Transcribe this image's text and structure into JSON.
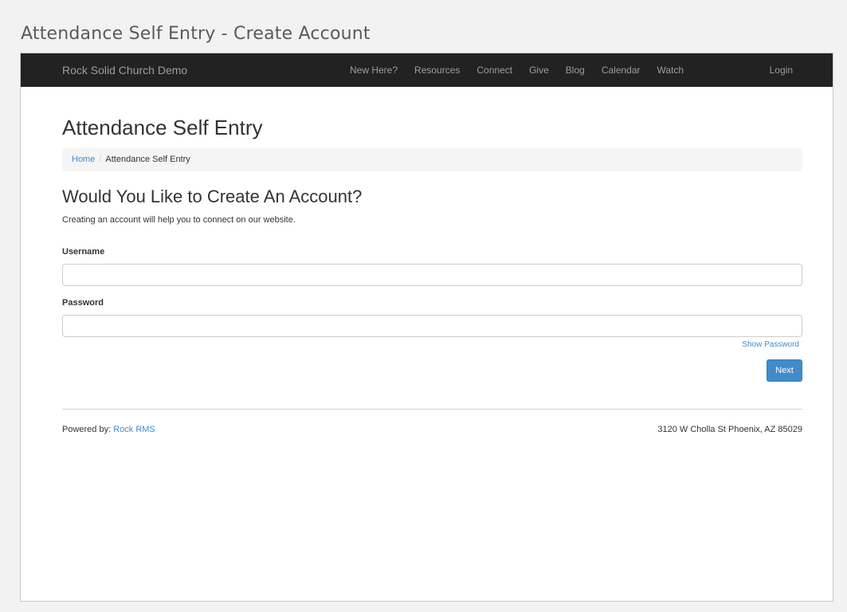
{
  "doc_title": "Attendance Self Entry - Create Account",
  "navbar": {
    "brand": "Rock Solid Church Demo",
    "links": [
      "New Here?",
      "Resources",
      "Connect",
      "Give",
      "Blog",
      "Calendar",
      "Watch"
    ],
    "login": "Login"
  },
  "page": {
    "title": "Attendance Self Entry",
    "breadcrumb": {
      "home": "Home",
      "separator": "/",
      "current": "Attendance Self Entry"
    }
  },
  "form": {
    "heading": "Would You Like to Create An Account?",
    "intro": "Creating an account will help you to connect on our website.",
    "username_label": "Username",
    "username_value": "",
    "password_label": "Password",
    "password_value": "",
    "show_password": "Show Password",
    "next_label": "Next"
  },
  "footer": {
    "powered_prefix": "Powered by: ",
    "powered_link": "Rock RMS",
    "address": "3120 W Cholla St Phoenix, AZ 85029"
  },
  "colors": {
    "navbar_bg": "#222222",
    "link": "#428bca",
    "primary_button": "#428bca"
  }
}
